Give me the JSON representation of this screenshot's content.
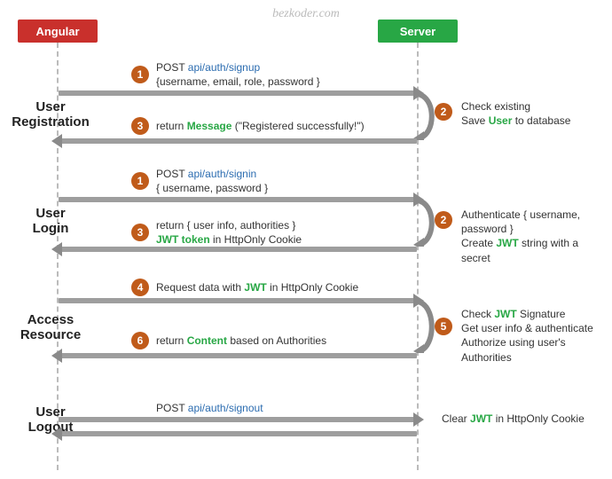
{
  "watermark": "bezkoder.com",
  "participants": {
    "left": "Angular",
    "right": "Server"
  },
  "sections": {
    "registration": "User\nRegistration",
    "login": "User\nLogin",
    "access": "Access\nResource",
    "logout": "User\nLogout"
  },
  "steps": {
    "s1_verb": "POST ",
    "s1_path": "api/auth/signup",
    "s1_body": "{username, email, role, password }",
    "s2_l1": "Check existing",
    "s2_l2a": "Save ",
    "s2_l2b": "User",
    "s2_l2c": " to database",
    "s3_a": "return ",
    "s3_b": "Message",
    "s3_c": " (\"Registered successfully!\")",
    "s4_verb": "POST ",
    "s4_path": "api/auth/signin",
    "s4_body": "{ username, password }",
    "s5_l1": "Authenticate { username, password }",
    "s5_l2a": "Create ",
    "s5_l2b": "JWT",
    "s5_l2c": " string with a secret",
    "s6_l1": "return { user info, authorities }",
    "s6_l2a": "JWT token",
    "s6_l2b": " in HttpOnly Cookie",
    "s7_a": "Request data with ",
    "s7_b": "JWT",
    "s7_c": " in HttpOnly Cookie",
    "s8_l1a": "Check ",
    "s8_l1b": "JWT",
    "s8_l1c": " Signature",
    "s8_l2": "Get user info & authenticate",
    "s8_l3": "Authorize using user's Authorities",
    "s9_a": "return ",
    "s9_b": "Content",
    "s9_c": " based on Authorities",
    "s10_verb": "POST ",
    "s10_path": "api/auth/signout",
    "s11_a": "Clear ",
    "s11_b": "JWT",
    "s11_c": " in HttpOnly Cookie"
  },
  "nums": {
    "n1": "1",
    "n2": "2",
    "n3": "3",
    "n4": "4",
    "n5": "5",
    "n6": "6"
  }
}
